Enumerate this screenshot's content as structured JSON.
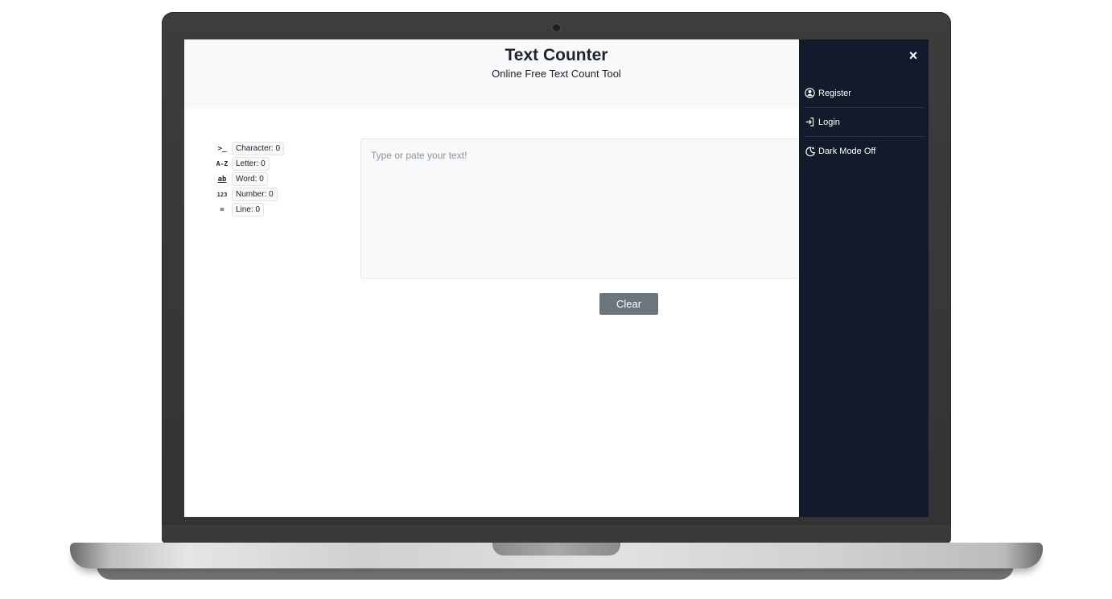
{
  "header": {
    "title": "Text Counter",
    "subtitle": "Online Free Text Count Tool"
  },
  "stats": [
    {
      "icon": "terminal-icon",
      "glyph": ">_",
      "label": "Character: 0"
    },
    {
      "icon": "a-z-icon",
      "glyph": "A-Z",
      "label": "Letter: 0"
    },
    {
      "icon": "ab-icon",
      "glyph": "ab",
      "label": "Word: 0"
    },
    {
      "icon": "numbers-icon",
      "glyph": "123",
      "label": "Number: 0"
    },
    {
      "icon": "lines-icon",
      "glyph": "=",
      "label": "Line: 0"
    }
  ],
  "editor": {
    "placeholder": "Type or pate your text!",
    "value": ""
  },
  "actions": {
    "clear_label": "Clear"
  },
  "sidebar": {
    "close_glyph": "×",
    "items": [
      {
        "label": "Register",
        "icon": "user-circle-icon"
      },
      {
        "label": "Login",
        "icon": "login-icon"
      },
      {
        "label": "Dark Mode Off",
        "icon": "moon-icon"
      }
    ]
  },
  "colors": {
    "sidebar_bg": "#131a2b",
    "header_bg": "#f8f9fa",
    "button_bg": "#6c757d"
  }
}
